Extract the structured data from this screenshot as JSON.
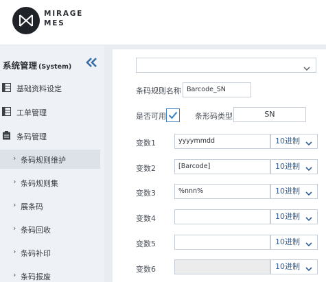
{
  "brand": {
    "line1": "MIRAGE",
    "line2": "MES"
  },
  "sidebar": {
    "title": "系统管理",
    "title_sub": "(System)",
    "collapse_icon": "double-chevron-left-icon",
    "groups": [
      {
        "label": "基础资料设定",
        "icon": "table-icon"
      },
      {
        "label": "工单管理",
        "icon": "table-icon"
      },
      {
        "label": "条码管理",
        "icon": "clipboard-icon"
      }
    ],
    "sub_items": [
      {
        "label": "条码规则维护",
        "active": true
      },
      {
        "label": "条码规则集",
        "active": false
      },
      {
        "label": "展条码",
        "active": false
      },
      {
        "label": "条码回收",
        "active": false
      },
      {
        "label": "条码补印",
        "active": false
      },
      {
        "label": "条码报废",
        "active": false
      }
    ]
  },
  "form": {
    "top_select_value": "",
    "rule_name_label": "条码规则名称",
    "rule_name_value": "Barcode_SN",
    "enabled_label": "是否可用",
    "enabled_checked": true,
    "barcode_type_label": "条形码类型",
    "barcode_type_value": "SN",
    "variables": [
      {
        "label": "变数1",
        "value": "yyyymmdd",
        "base": "10进制",
        "disabled": false
      },
      {
        "label": "变数2",
        "value": "[Barcode]",
        "base": "10进制",
        "disabled": false
      },
      {
        "label": "变数3",
        "value": "%nnn%",
        "base": "10进制",
        "disabled": false
      },
      {
        "label": "变数4",
        "value": "",
        "base": "10进制",
        "disabled": false
      },
      {
        "label": "变数5",
        "value": "",
        "base": "10进制",
        "disabled": false
      },
      {
        "label": "变数6",
        "value": "",
        "base": "10进制",
        "disabled": true
      }
    ]
  },
  "colors": {
    "accent": "#3d7fc4",
    "select_text": "#2f5f95",
    "logo_bg": "#1f2328"
  }
}
